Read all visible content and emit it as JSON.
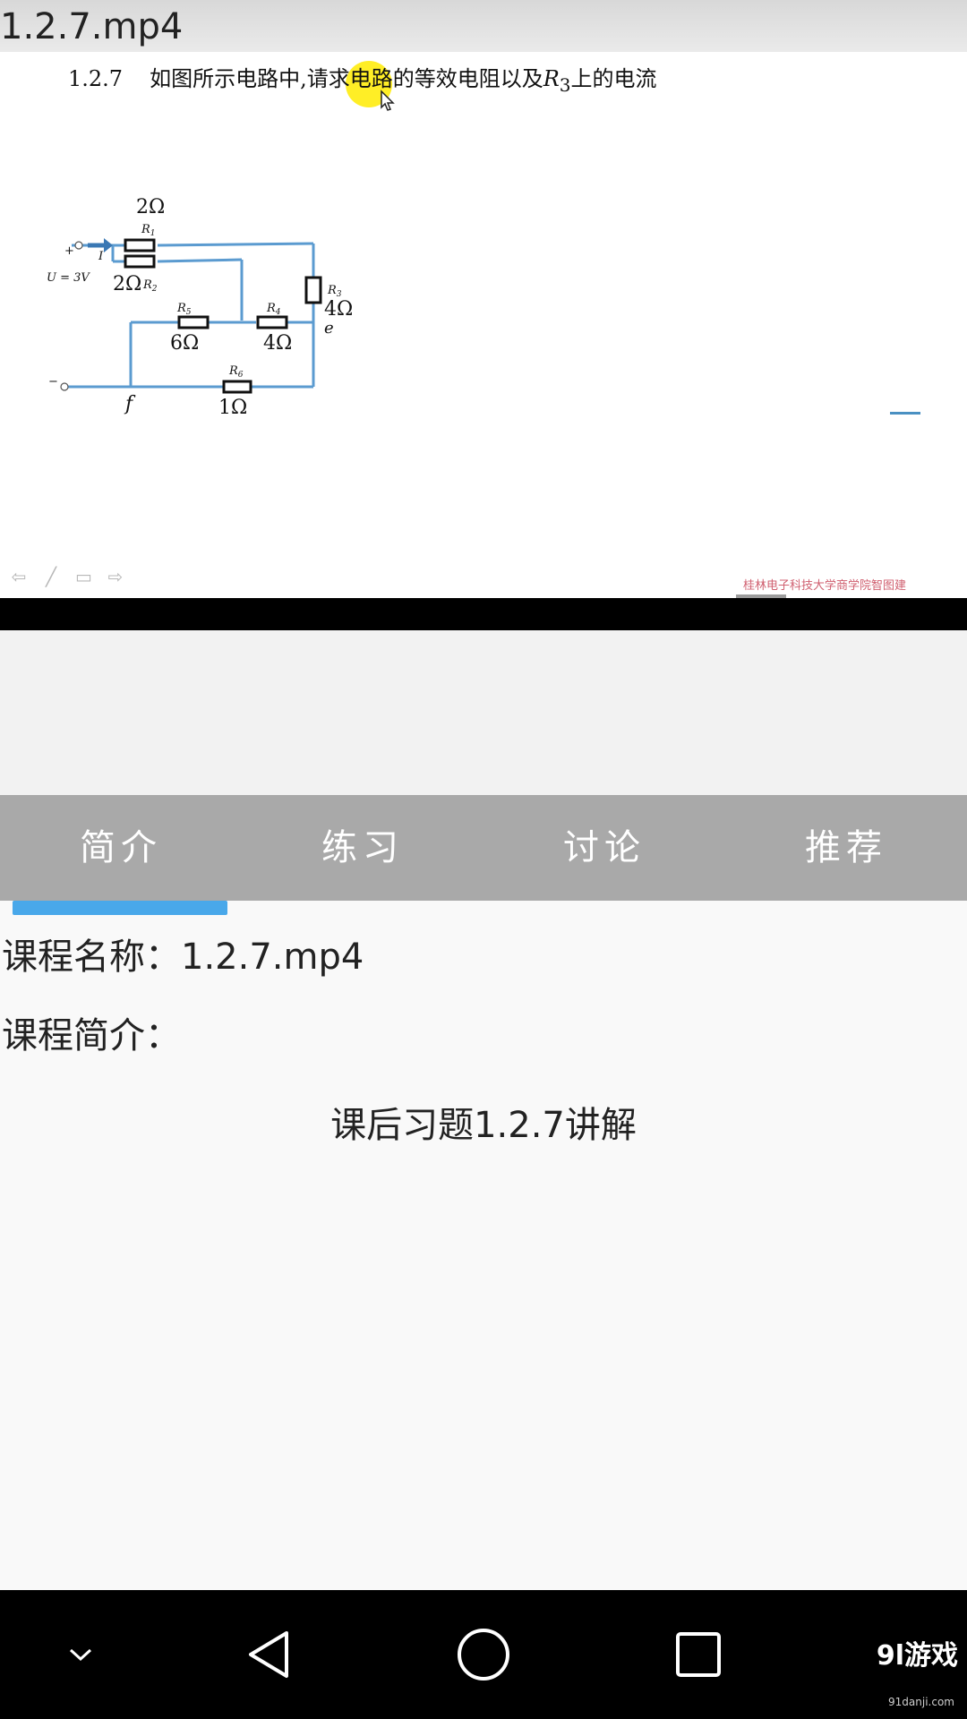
{
  "video": {
    "title": "1.2.7.mp4",
    "problem_number": "1.2.7",
    "problem_text_prefix": "如图所示电路中,请求电路的等效电阻以及",
    "problem_var": "R",
    "problem_sub": "3",
    "problem_text_suffix": "上的电流",
    "watermark": "桂林电子科技大学商学院智图建",
    "circuit": {
      "r1_value": "2Ω",
      "r1_label": "R",
      "r1_sub": "1",
      "r2_value": "2Ω",
      "r2_label": "R",
      "r2_sub": "2",
      "r3_value": "4Ω",
      "r3_label": "R",
      "r3_sub": "3",
      "r4_value": "4Ω",
      "r4_label": "R",
      "r4_sub": "4",
      "r5_value": "6Ω",
      "r5_label": "R",
      "r5_sub": "5",
      "r6_value": "1Ω",
      "r6_label": "R",
      "r6_sub": "6",
      "voltage": "U = 3V",
      "plus": "+",
      "minus": "−",
      "current": "I",
      "node_e": "e",
      "node_f": "f"
    }
  },
  "tabs": [
    {
      "label": "简介"
    },
    {
      "label": "练习"
    },
    {
      "label": "讨论"
    },
    {
      "label": "推荐"
    }
  ],
  "content": {
    "course_name": "课程名称：1.2.7.mp4",
    "course_desc_label": "课程简介：",
    "course_desc": "课后习题1.2.7讲解"
  },
  "brand": {
    "name": "9l游戏",
    "url": "91danji.com"
  },
  "colors": {
    "tab_bar": "#a9a9a9",
    "tab_indicator": "#49a8ea",
    "circuit_wire": "#5b9bd0"
  }
}
